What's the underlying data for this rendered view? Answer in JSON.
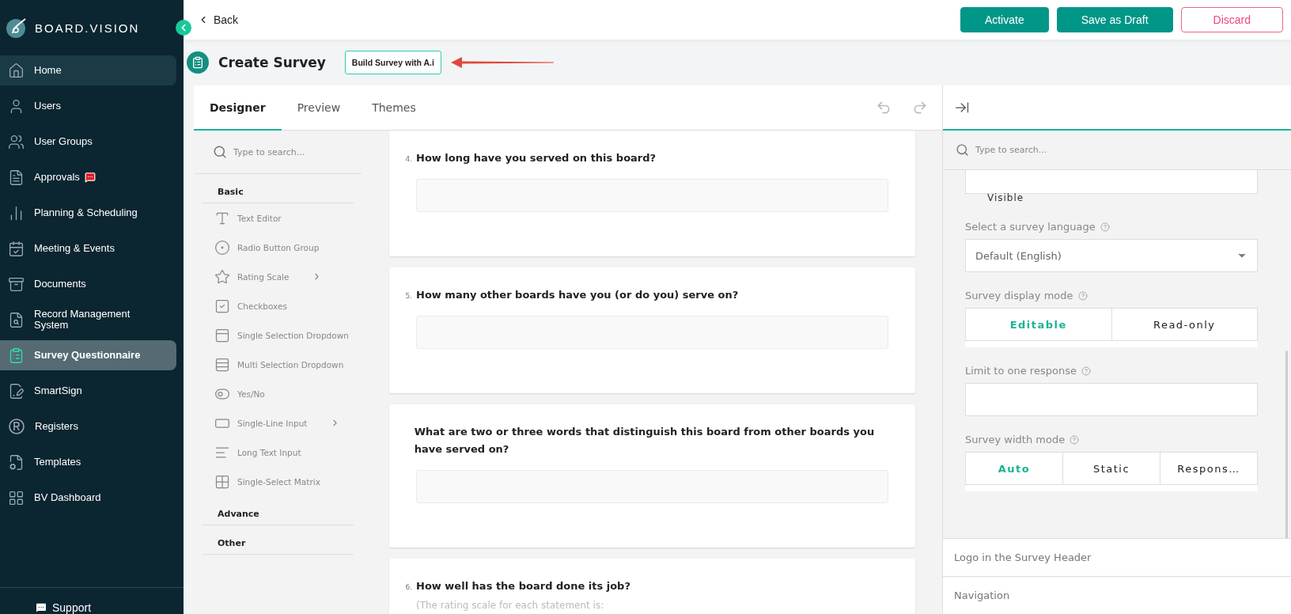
{
  "brand": {
    "name": "BOARD.VISION"
  },
  "nav": [
    {
      "label": "Home",
      "selected": false,
      "hovered": true
    },
    {
      "label": "Users",
      "selected": false
    },
    {
      "label": "User Groups",
      "selected": false
    },
    {
      "label": "Approvals",
      "selected": false,
      "badge": true
    },
    {
      "label": "Planning & Scheduling",
      "selected": false
    },
    {
      "label": "Meeting & Events",
      "selected": false
    },
    {
      "label": "Documents",
      "selected": false
    },
    {
      "label": "Record Management System",
      "selected": false
    },
    {
      "label": "Survey Questionnaire",
      "selected": true
    },
    {
      "label": "SmartSign",
      "selected": false
    },
    {
      "label": "Registers",
      "selected": false
    },
    {
      "label": "Templates",
      "selected": false
    },
    {
      "label": "BV Dashboard",
      "selected": false
    }
  ],
  "support": "Support",
  "topbar": {
    "back": "Back",
    "buttons": [
      {
        "label": "Activate",
        "kind": "primary"
      },
      {
        "label": "Save as Draft",
        "kind": "primary"
      },
      {
        "label": "Discard",
        "kind": "danger"
      }
    ]
  },
  "header": {
    "title": "Create Survey",
    "ai_button": "Build Survey with A.i"
  },
  "tabs": [
    {
      "label": "Designer",
      "selected": true
    },
    {
      "label": "Preview",
      "selected": false
    },
    {
      "label": "Themes",
      "selected": false
    }
  ],
  "toolbox": {
    "search_placeholder": "Type to search...",
    "sections": [
      {
        "title": "Basic",
        "items": [
          {
            "label": "Text Editor",
            "submenu": false
          },
          {
            "label": "Radio Button Group",
            "submenu": false
          },
          {
            "label": "Rating Scale",
            "submenu": true
          },
          {
            "label": "Checkboxes",
            "submenu": false
          },
          {
            "label": "Single Selection Dropdown",
            "submenu": false
          },
          {
            "label": "Multi Selection Dropdown",
            "submenu": false
          },
          {
            "label": "Yes/No",
            "submenu": false
          },
          {
            "label": "Single-Line Input",
            "submenu": true
          },
          {
            "label": "Long Text Input",
            "submenu": false
          },
          {
            "label": "Single-Select Matrix",
            "submenu": false
          }
        ]
      },
      {
        "title": "Advance"
      },
      {
        "title": "Other"
      }
    ]
  },
  "questions": [
    {
      "number": "4.",
      "title": "How long have you served on this board?"
    },
    {
      "number": "5.",
      "title": "How many other boards have you (or do you) serve on?"
    },
    {
      "title": "What are two or three words that distinguish this board from other boards you have served on?"
    },
    {
      "number": "6.",
      "title": "How well has the board done its job?",
      "note": "(The rating scale for each statement is:"
    }
  ],
  "properties": {
    "search_placeholder": "Type to search...",
    "visible_label": "Visible",
    "language": {
      "label": "Select a survey language",
      "value": "Default (English)"
    },
    "display_mode": {
      "label": "Survey display mode",
      "options": [
        {
          "label": "Editable",
          "selected": true
        },
        {
          "label": "Read-only",
          "selected": false
        }
      ]
    },
    "limit": {
      "label": "Limit to one response"
    },
    "width_mode": {
      "label": "Survey width mode",
      "options": [
        {
          "label": "Auto",
          "selected": true
        },
        {
          "label": "Static",
          "selected": false
        },
        {
          "label": "Respons…",
          "selected": false
        }
      ]
    },
    "sections": [
      "Logo in the Survey Header",
      "Navigation"
    ]
  }
}
